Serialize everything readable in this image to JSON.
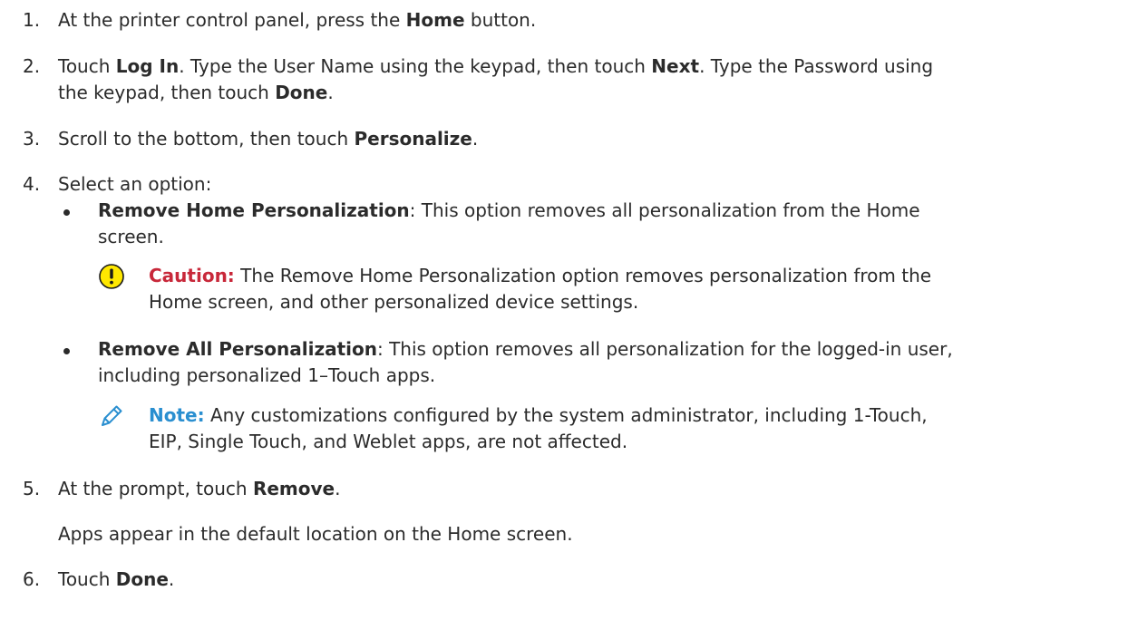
{
  "steps": [
    {
      "num": "1.",
      "pre": "At the printer control panel, press the ",
      "b1": "Home",
      "post": " button."
    },
    {
      "num": "2.",
      "t1": "Touch ",
      "b1": "Log In",
      "t2": ". Type the User Name using the keypad, then touch ",
      "b2": "Next",
      "t3": ". Type the Password using",
      "t4": "the keypad, then touch ",
      "b3": "Done",
      "t5": "."
    },
    {
      "num": "3.",
      "pre": "Scroll to the bottom, then touch ",
      "b1": "Personalize",
      "post": "."
    },
    {
      "num": "4.",
      "text": "Select an option:"
    },
    {
      "num": "5.",
      "pre": "At the prompt, touch ",
      "b1": "Remove",
      "post": "."
    },
    {
      "num": "6.",
      "pre": "Touch ",
      "b1": "Done",
      "post": "."
    }
  ],
  "options": [
    {
      "bold": "Remove Home Personalization",
      "rest_line1": ": This option removes all personalization from the Home",
      "line2": "screen."
    },
    {
      "bold": "Remove All Personalization",
      "rest_line1": ": This option removes all personalization for the logged-in user,",
      "line2": "including personalized 1–Touch apps."
    }
  ],
  "caution": {
    "label": "Caution:",
    "line1": " The Remove Home Personalization option removes personalization from the",
    "line2": "Home screen, and other personalized device settings.",
    "icon": "caution-icon",
    "color": "#c8283a"
  },
  "note": {
    "label": "Note:",
    "line1": " Any customizations configured by the system administrator, including 1-Touch,",
    "line2": "EIP, Single Touch, and Weblet apps, are not affected.",
    "icon": "pencil-note-icon",
    "color": "#2a8fd0"
  },
  "step5_followup": "Apps appear in the default location on the Home screen."
}
